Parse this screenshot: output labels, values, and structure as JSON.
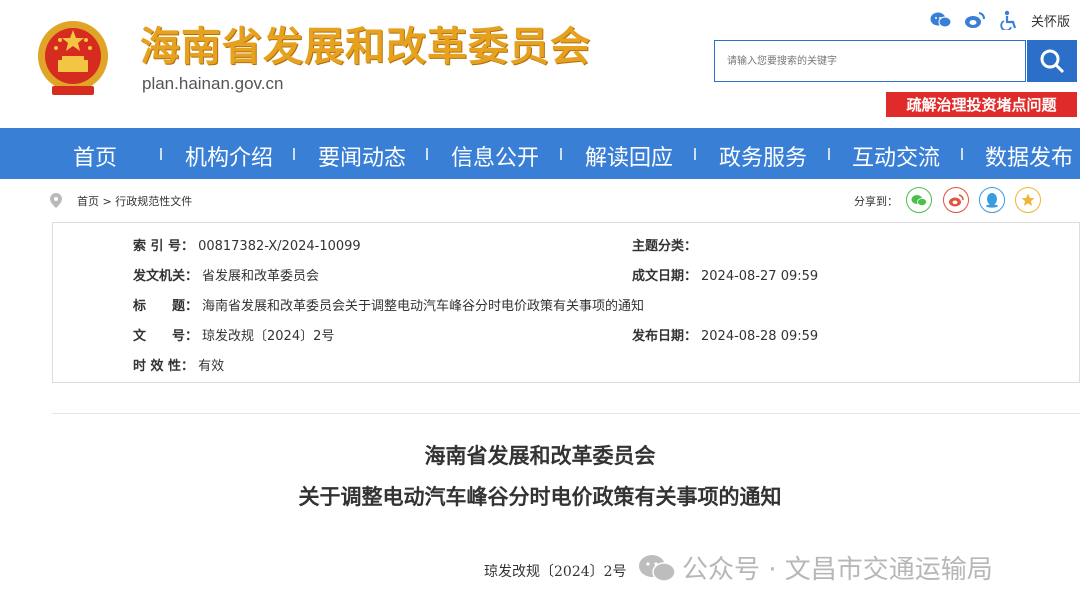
{
  "header": {
    "site_title": "海南省发展和改革委员会",
    "domain": "plan.hainan.gov.cn",
    "care_mode": "关怀版",
    "search_placeholder": "请输入您要搜索的关键字",
    "promo_banner": "疏解治理投资堵点问题",
    "icons": [
      "wechat-icon",
      "weibo-icon",
      "accessibility-icon",
      "search-icon"
    ]
  },
  "nav": {
    "items": [
      "首页",
      "机构介绍",
      "要闻动态",
      "信息公开",
      "解读回应",
      "政务服务",
      "互动交流",
      "数据发布"
    ]
  },
  "breadcrumb": {
    "text": "首页 > 行政规范性文件"
  },
  "share": {
    "label": "分享到：",
    "icons": [
      "wechat-icon",
      "weibo-icon",
      "qq-icon",
      "qzone-icon"
    ]
  },
  "meta": {
    "index_no": {
      "key": "索 引 号：",
      "value": "00817382-X/2024-10099"
    },
    "topic": {
      "key": "主题分类：",
      "value": ""
    },
    "issuer": {
      "key": "发文机关：",
      "value": "省发展和改革委员会"
    },
    "written": {
      "key": "成文日期：",
      "value": "2024-08-27 09:59"
    },
    "title": {
      "key": "标　　题：",
      "value": "海南省发展和改革委员会关于调整电动汽车峰谷分时电价政策有关事项的通知"
    },
    "doc_no": {
      "key": "文　　号：",
      "value": "琼发改规〔2024〕2号"
    },
    "published": {
      "key": "发布日期：",
      "value": "2024-08-28 09:59"
    },
    "validity": {
      "key": "时 效 性：",
      "value": "有效"
    }
  },
  "document": {
    "title_line1": "海南省发展和改革委员会",
    "title_line2": "关于调整电动汽车峰谷分时电价政策有关事项的通知",
    "doc_number": "琼发改规〔2024〕2号"
  },
  "watermark": {
    "text": "公众号 · 文昌市交通运输局"
  },
  "colors": {
    "nav": "#3a7fd6",
    "promo": "#e02b2b",
    "title_gold": "#e6a21f",
    "search": "#2c6fc9"
  }
}
